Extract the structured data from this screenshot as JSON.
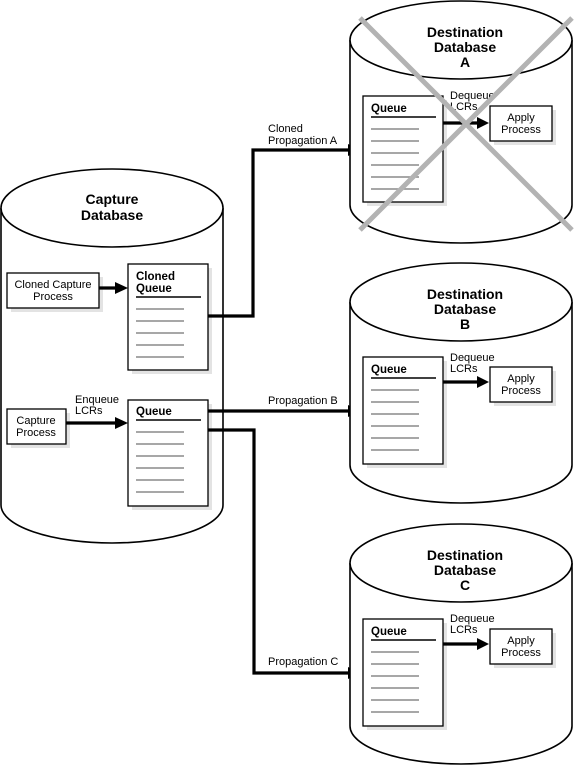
{
  "diagram": {
    "capture_database": {
      "title_line1": "Capture",
      "title_line2": "Database",
      "cloned_capture_process": {
        "line1": "Cloned Capture",
        "line2": "Process"
      },
      "capture_process": {
        "line1": "Capture",
        "line2": "Process"
      },
      "cloned_queue": {
        "line1": "Cloned",
        "line2": "Queue",
        "item_lines": 5
      },
      "queue": {
        "label": "Queue",
        "item_lines": 6
      },
      "enqueue_label": {
        "line1": "Enqueue",
        "line2": "LCRs"
      }
    },
    "propagations": [
      {
        "id": "cloned-propagation-a",
        "line1": "Cloned",
        "line2": "Propagation A"
      },
      {
        "id": "propagation-b",
        "line1": "Propagation B"
      },
      {
        "id": "propagation-c",
        "line1": "Propagation C"
      }
    ],
    "destinations": [
      {
        "id": "a",
        "title_line1": "Destination",
        "title_line2": "Database",
        "title_line3": "A",
        "crossed_out": true,
        "queue_label": "Queue",
        "dequeue_line1": "Dequeue",
        "dequeue_line2": "LCRs",
        "apply_line1": "Apply",
        "apply_line2": "Process"
      },
      {
        "id": "b",
        "title_line1": "Destination",
        "title_line2": "Database",
        "title_line3": "B",
        "crossed_out": false,
        "queue_label": "Queue",
        "dequeue_line1": "Dequeue",
        "dequeue_line2": "LCRs",
        "apply_line1": "Apply",
        "apply_line2": "Process"
      },
      {
        "id": "c",
        "title_line1": "Destination",
        "title_line2": "Database",
        "title_line3": "C",
        "crossed_out": false,
        "queue_label": "Queue",
        "dequeue_line1": "Dequeue",
        "dequeue_line2": "LCRs",
        "apply_line1": "Apply",
        "apply_line2": "Process"
      }
    ],
    "colors": {
      "line": "#000000",
      "cross_mark": "#b3b3b3",
      "shadow": "#e3e3e3",
      "queue_item_line": "#8a8a8a"
    }
  }
}
